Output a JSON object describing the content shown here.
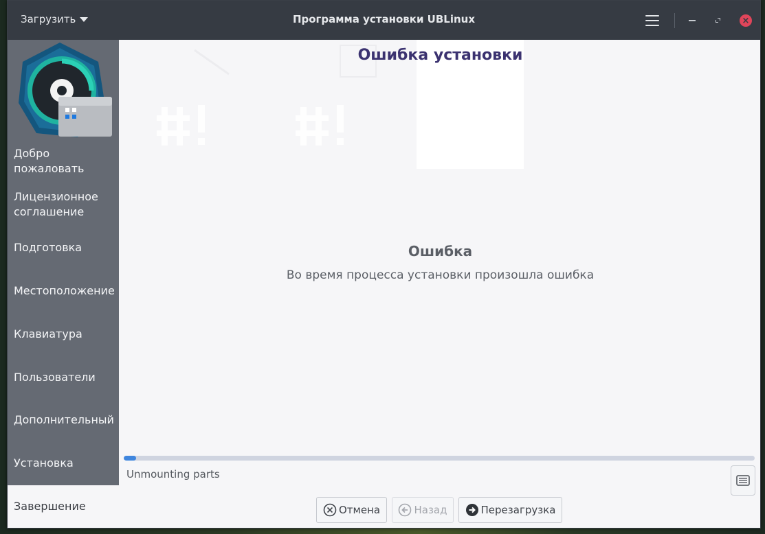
{
  "titlebar": {
    "menu_label": "Загрузить",
    "title": "Программа установки UBLinux"
  },
  "sidebar": {
    "items": [
      {
        "label": "Добро пожаловать"
      },
      {
        "label": "Лицензионное соглашение"
      },
      {
        "label": "Подготовка"
      },
      {
        "label": "Местоположение"
      },
      {
        "label": "Клавиатура"
      },
      {
        "label": "Пользователи"
      },
      {
        "label": "Дополнительный"
      },
      {
        "label": "Установка"
      },
      {
        "label": "Завершение"
      }
    ],
    "active_index": 8
  },
  "main": {
    "page_title": "Ошибка установки",
    "error_heading": "Ошибка",
    "error_text": "Во время процесса установки произошла ошибка",
    "progress_fraction": 0.02,
    "status_text": "Unmounting parts"
  },
  "buttons": {
    "cancel": "Отмена",
    "back": "Назад",
    "reboot": "Перезагрузка"
  },
  "colors": {
    "accent": "#3f86de",
    "title": "#3b3270",
    "sidebar": "#656a73",
    "titlebar": "#363b43",
    "close": "#e0455a"
  },
  "icons": {
    "menu": "hamburger-icon",
    "cancel": "cancel-circle-icon",
    "back": "arrow-left-circle-icon",
    "reboot": "arrow-right-circle-icon",
    "log": "log-list-icon",
    "logo": "ublinux-logo-icon"
  }
}
